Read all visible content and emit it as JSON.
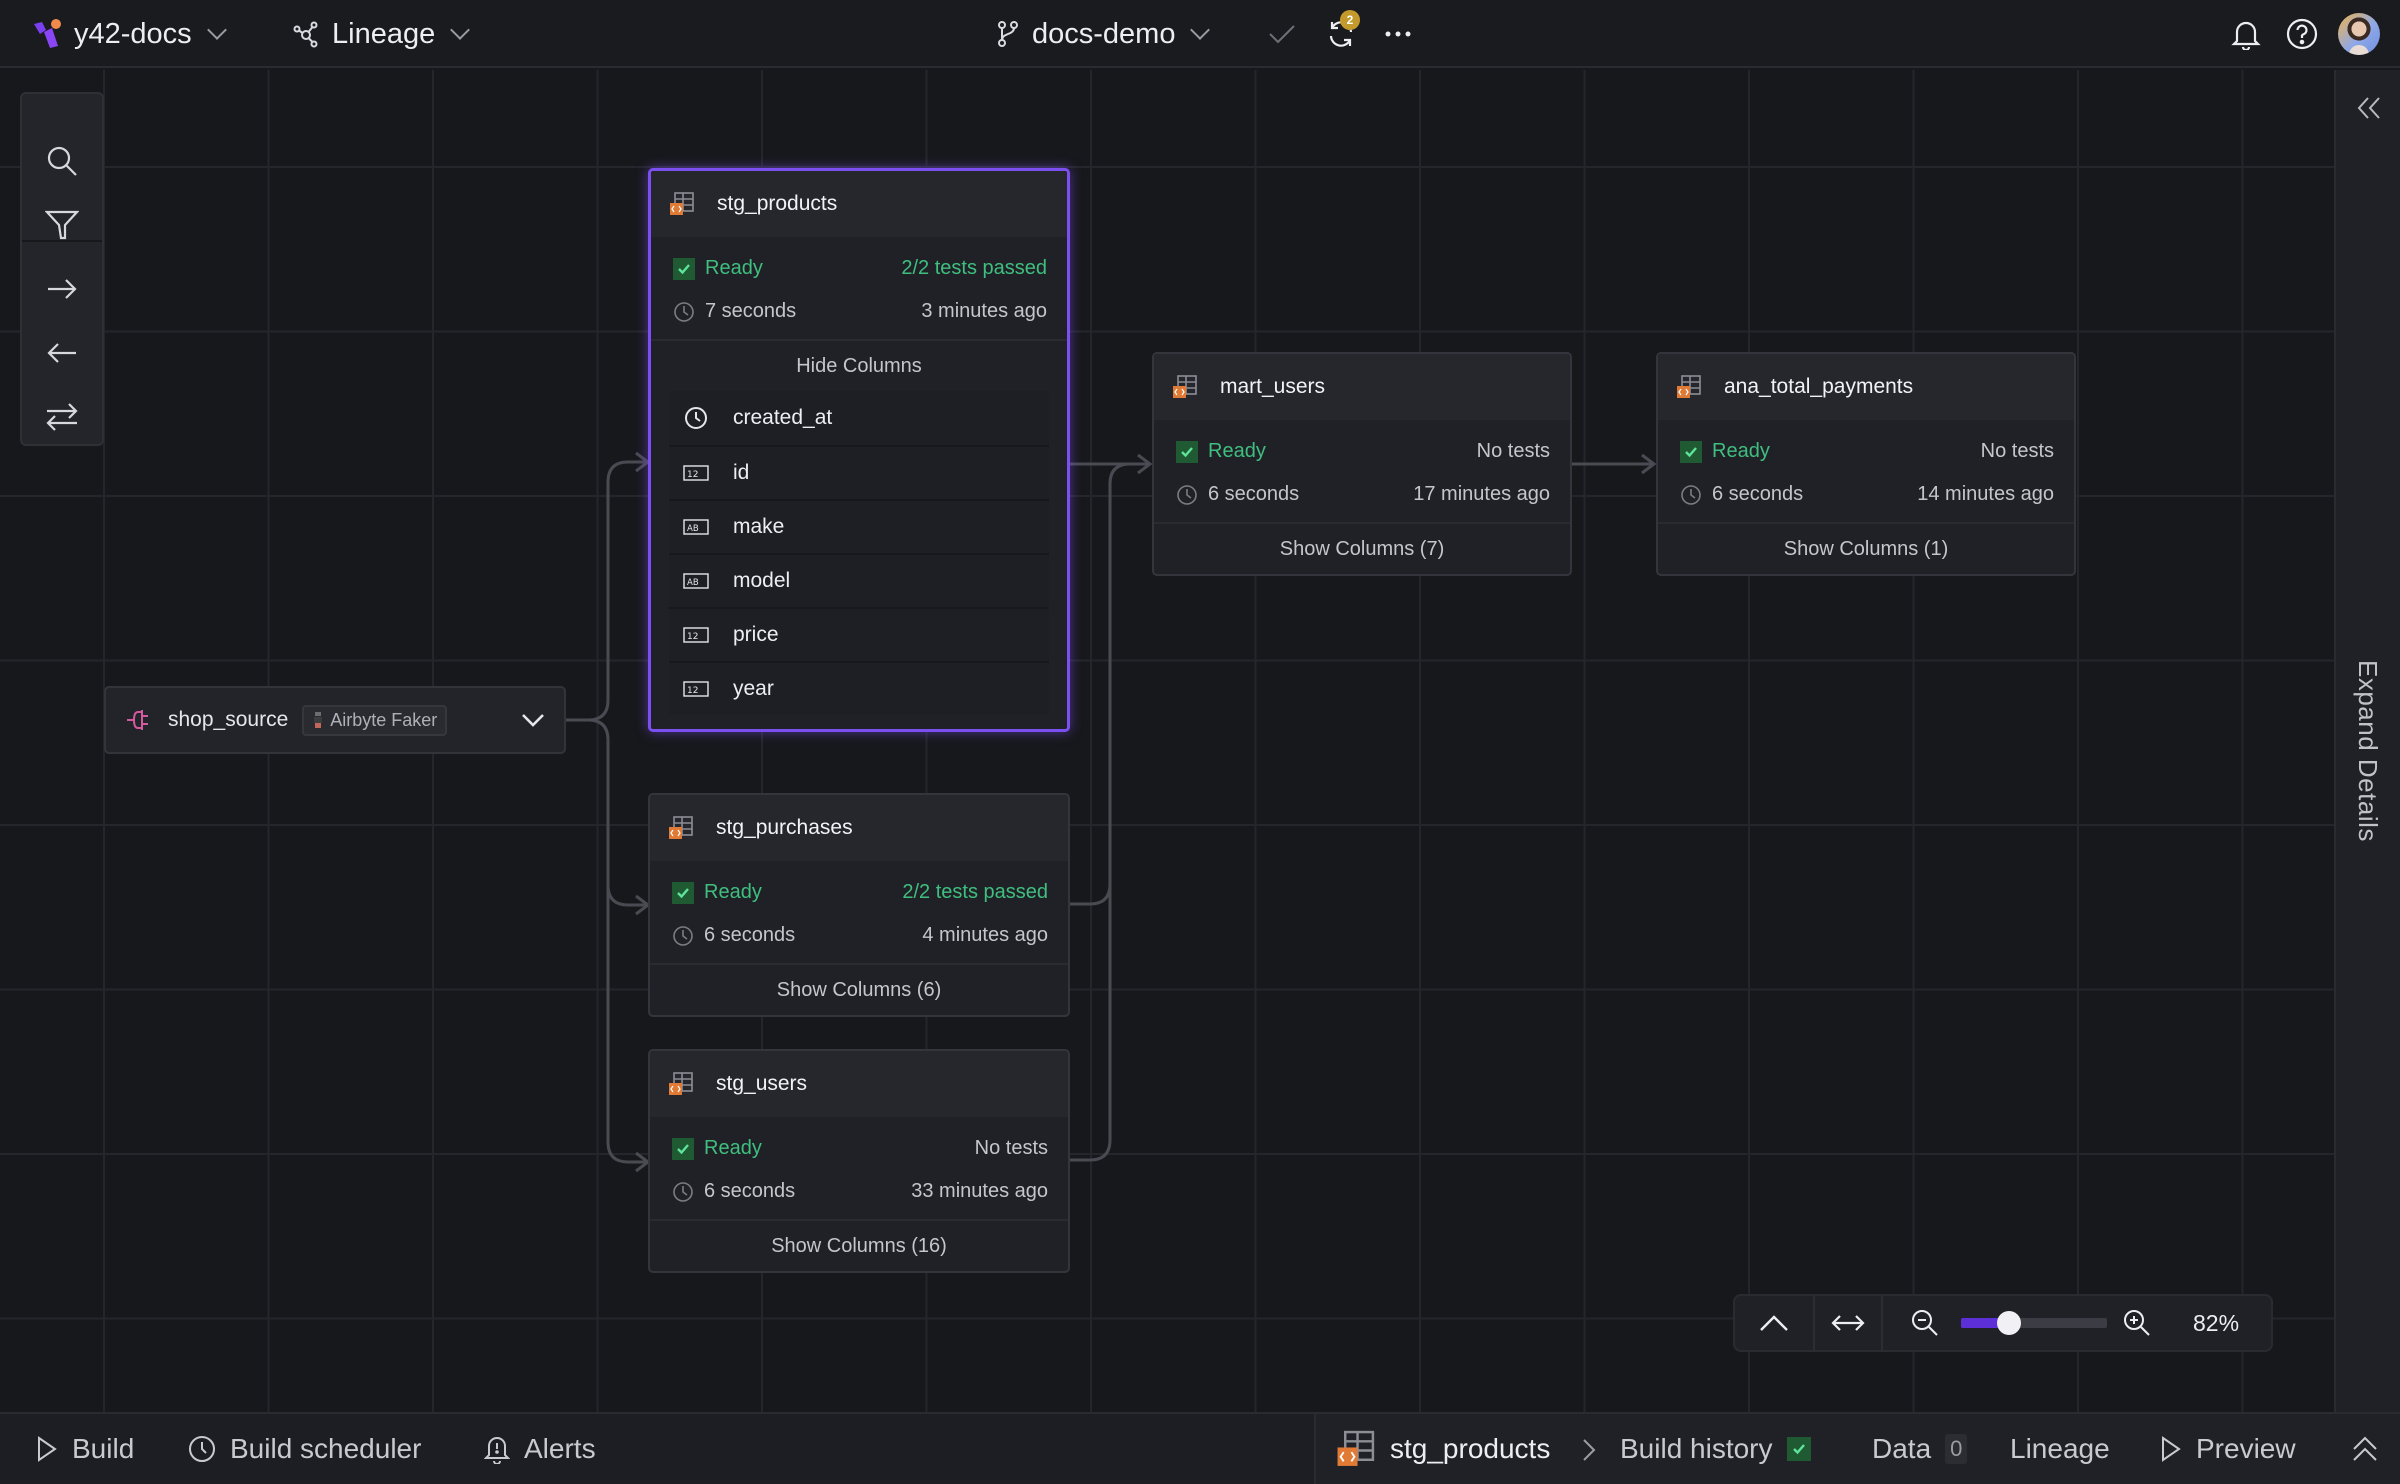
{
  "topbar": {
    "workspace": "y42-docs",
    "view": "Lineage",
    "branch": "docs-demo",
    "sync_badge_count": "2",
    "icons": [
      "y42-logo",
      "lineage-icon",
      "branch-icon",
      "commit-check-icon",
      "sync-icon",
      "more-icon",
      "bell-icon",
      "help-icon",
      "avatar"
    ]
  },
  "toolbox": {
    "tools": [
      "search",
      "filter",
      "upstream-arrow",
      "downstream-arrow",
      "both-directions"
    ]
  },
  "source_node": {
    "name": "shop_source",
    "connector": "Airbyte Faker"
  },
  "nodes": {
    "stg_products": {
      "name": "stg_products",
      "status": "Ready",
      "tests": "2/2 tests passed",
      "duration": "7 seconds",
      "updated": "3 minutes ago",
      "columns_toggle": "Hide Columns",
      "columns": [
        {
          "name": "created_at",
          "type": "timestamp"
        },
        {
          "name": "id",
          "type": "number"
        },
        {
          "name": "make",
          "type": "string"
        },
        {
          "name": "model",
          "type": "string"
        },
        {
          "name": "price",
          "type": "number"
        },
        {
          "name": "year",
          "type": "number"
        }
      ]
    },
    "stg_purchases": {
      "name": "stg_purchases",
      "status": "Ready",
      "tests": "2/2 tests passed",
      "duration": "6 seconds",
      "updated": "4 minutes ago",
      "columns_toggle": "Show Columns (6)"
    },
    "stg_users": {
      "name": "stg_users",
      "status": "Ready",
      "tests": "No tests",
      "duration": "6 seconds",
      "updated": "33 minutes ago",
      "columns_toggle": "Show Columns (16)"
    },
    "mart_users": {
      "name": "mart_users",
      "status": "Ready",
      "tests": "No tests",
      "duration": "6 seconds",
      "updated": "17 minutes ago",
      "columns_toggle": "Show Columns (7)"
    },
    "ana_total_payments": {
      "name": "ana_total_payments",
      "status": "Ready",
      "tests": "No tests",
      "duration": "6 seconds",
      "updated": "14 minutes ago",
      "columns_toggle": "Show Columns (1)"
    }
  },
  "zoom_controls": {
    "zoom_label": "82%",
    "zoom_value": 82,
    "slider_fraction": 0.33
  },
  "right_rail": {
    "label": "Expand Details"
  },
  "bottombar": {
    "build": "Build",
    "build_scheduler": "Build scheduler",
    "alerts": "Alerts",
    "asset": "stg_products",
    "build_history": "Build history",
    "data": "Data",
    "data_count": "0",
    "lineage": "Lineage",
    "preview": "Preview"
  },
  "colors": {
    "accent": "#7c4ff0",
    "ready": "#3fbf7f",
    "model_icon": "#e07a34",
    "badge": "#c49a2c"
  }
}
